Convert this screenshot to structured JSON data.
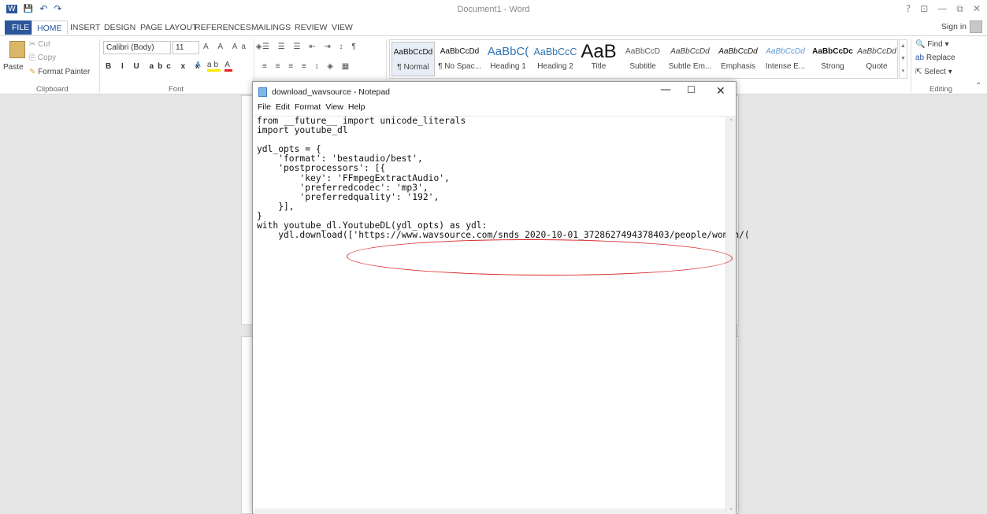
{
  "word": {
    "title": "Document1 - Word",
    "window_controls": [
      "?",
      "⊡",
      "—",
      "⧉",
      "✕"
    ],
    "qat": [
      "W",
      "💾",
      "↶",
      "↷"
    ],
    "sign_in": "Sign in",
    "tabs": [
      "FILE",
      "HOME",
      "INSERT",
      "DESIGN",
      "PAGE LAYOUT",
      "REFERENCES",
      "MAILINGS",
      "REVIEW",
      "VIEW"
    ],
    "clipboard": {
      "paste": "Paste",
      "cut": "Cut",
      "copy": "Copy",
      "format_painter": "Format Painter",
      "label": "Clipboard"
    },
    "font": {
      "name": "Calibri (Body)",
      "size": "11",
      "label": "Font"
    },
    "styles": [
      {
        "preview": "AaBbCcDd",
        "name": "¶ Normal"
      },
      {
        "preview": "AaBbCcDd",
        "name": "¶ No Spac..."
      },
      {
        "preview": "AaBbC(",
        "name": "Heading 1"
      },
      {
        "preview": "AaBbCcC",
        "name": "Heading 2"
      },
      {
        "preview": "AaB",
        "name": "Title"
      },
      {
        "preview": "AaBbCcD",
        "name": "Subtitle"
      },
      {
        "preview": "AaBbCcDd",
        "name": "Subtle Em..."
      },
      {
        "preview": "AaBbCcDd",
        "name": "Emphasis"
      },
      {
        "preview": "AaBbCcDd",
        "name": "Intense E..."
      },
      {
        "preview": "AaBbCcDc",
        "name": "Strong"
      },
      {
        "preview": "AaBbCcDd",
        "name": "Quote"
      }
    ],
    "editing": {
      "find": "Find",
      "replace": "Replace",
      "select": "Select",
      "label": "Editing"
    }
  },
  "notepad": {
    "title": "download_wavsource - Notepad",
    "menu": [
      "File",
      "Edit",
      "Format",
      "View",
      "Help"
    ],
    "code": "from __future__ import unicode_literals\nimport youtube_dl\n\nydl_opts = {\n    'format': 'bestaudio/best',\n    'postprocessors': [{\n        'key': 'FFmpegExtractAudio',\n        'preferredcodec': 'mp3',\n        'preferredquality': '192',\n    }],\n}\nwith youtube_dl.YoutubeDL(ydl_opts) as ydl:\n    ydl.download(['https://www.wavsource.com/snds_2020-10-01_3728627494378403/people/women/("
  },
  "colors": {
    "ribbon_accent": "#2b579a",
    "annotation": "#d8282a"
  }
}
